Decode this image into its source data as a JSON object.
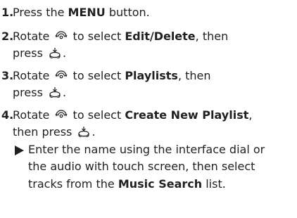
{
  "steps": [
    {
      "num": "1.",
      "pre": "Press the ",
      "bold": "MENU",
      "post": " button."
    },
    {
      "num": "2.",
      "pre": "Rotate ",
      "mid": " to select ",
      "bold": "Edit/Delete",
      "post": ", then",
      "line2": "press ",
      "end": "."
    },
    {
      "num": "3.",
      "pre": "Rotate ",
      "mid": " to select ",
      "bold": "Playlists",
      "post": ", then",
      "line2": "press ",
      "end": "."
    },
    {
      "num": "4.",
      "pre": "Rotate ",
      "mid": " to select ",
      "bold": "Create New Playlist",
      "post": ",",
      "line2": "then press ",
      "end": ".",
      "note": {
        "l1": "Enter the name using the interface dial or",
        "l2": "the audio with touch screen, then select",
        "l3a": "tracks from the ",
        "l3b": "Music Search",
        "l3c": " list."
      }
    }
  ],
  "icons": {
    "rotate": "rotate-dial-icon",
    "press": "press-dial-icon"
  }
}
